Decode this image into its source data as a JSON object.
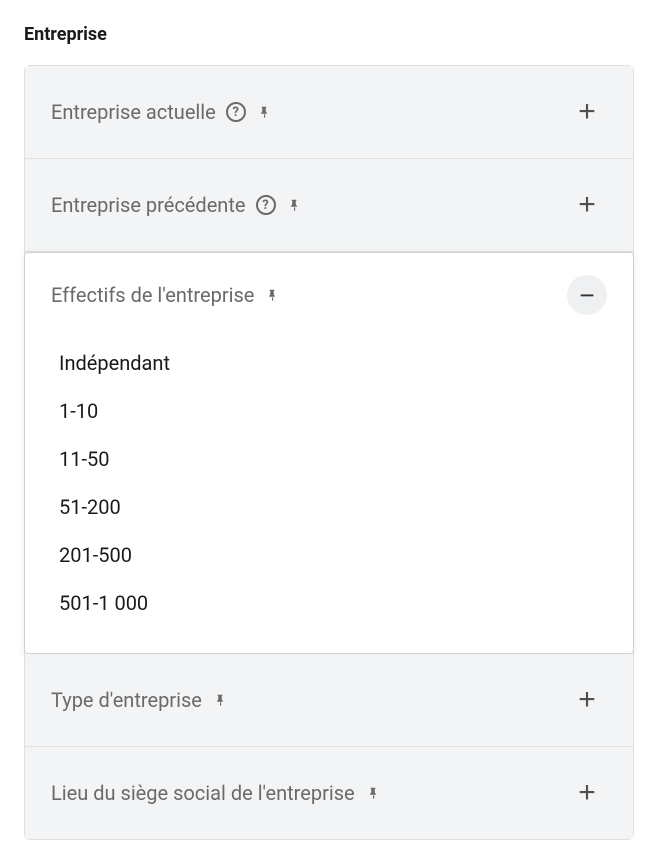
{
  "section_title": "Entreprise",
  "filters": {
    "current_company": {
      "label": "Entreprise actuelle"
    },
    "past_company": {
      "label": "Entreprise précédente"
    },
    "headcount": {
      "label": "Effectifs de l'entreprise",
      "options": [
        "Indépendant",
        "1-10",
        "11-50",
        "51-200",
        "201-500",
        "501-1 000"
      ]
    },
    "type": {
      "label": "Type d'entreprise"
    },
    "hq_location": {
      "label": "Lieu du siège social de l'entreprise"
    }
  }
}
